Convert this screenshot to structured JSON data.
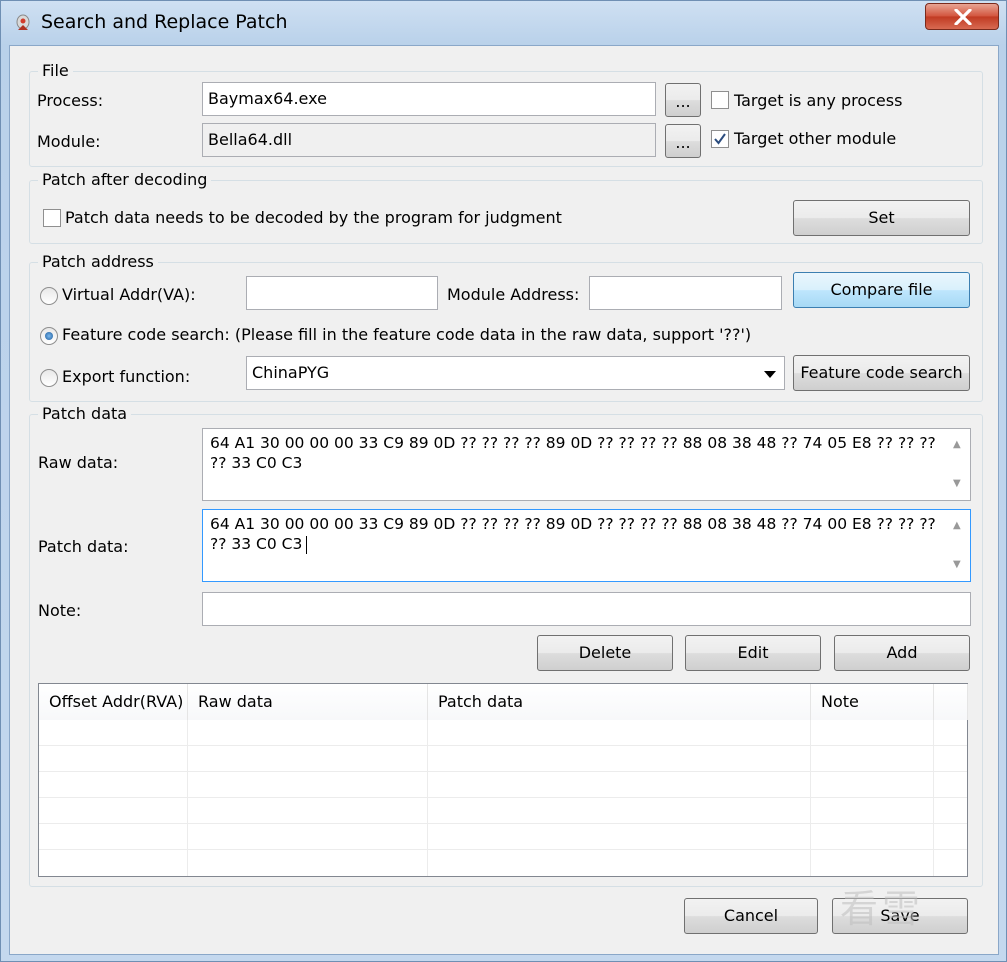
{
  "window": {
    "title": "Search and Replace Patch"
  },
  "file_group": {
    "label": "File",
    "process_label": "Process:",
    "process_value": "Baymax64.exe",
    "module_label": "Module:",
    "module_value": "Bella64.dll",
    "browse_label": "...",
    "target_any_process": {
      "label": "Target is any process",
      "checked": false
    },
    "target_other_module": {
      "label": "Target other module",
      "checked": true
    }
  },
  "decode_group": {
    "label": "Patch after decoding",
    "checkbox": {
      "label": "Patch data needs to be decoded by the program for judgment",
      "checked": false
    },
    "set_button": "Set"
  },
  "address_group": {
    "label": "Patch address",
    "va_radio": {
      "label": "Virtual Addr(VA):",
      "selected": false
    },
    "va_value": "",
    "module_address_label": "Module Address:",
    "module_address_value": "",
    "compare_button": "Compare file",
    "feature_radio": {
      "label": "Feature code search: (Please fill in the feature code data in the raw data, support '??')",
      "selected": true
    },
    "export_radio": {
      "label": "Export function:",
      "selected": false
    },
    "export_value": "ChinaPYG",
    "feature_search_button": "Feature code search"
  },
  "patch_group": {
    "label": "Patch data",
    "raw_label": "Raw data:",
    "raw_value": "64 A1 30 00 00 00 33 C9 89 0D ?? ?? ?? ?? 89 0D ?? ?? ?? ?? 88 08 38 48 ?? 74 05 E8 ?? ?? ?? ?? 33 C0 C3",
    "patch_label": "Patch data:",
    "patch_value": "64 A1 30 00 00 00 33 C9 89 0D ?? ?? ?? ?? 89 0D ?? ?? ?? ?? 88 08 38 48 ?? 74 00 E8 ?? ?? ?? ?? 33 C0 C3",
    "note_label": "Note:",
    "note_value": "",
    "delete_button": "Delete",
    "edit_button": "Edit",
    "add_button": "Add"
  },
  "table": {
    "columns": [
      "Offset Addr(RVA)",
      "Raw data",
      "Patch data",
      "Note"
    ],
    "rows": []
  },
  "footer": {
    "cancel_button": "Cancel",
    "save_button": "Save"
  },
  "colors": {
    "accent": "#3399ff",
    "close_button": "#c7412a",
    "titlebar": "#b9d1ea"
  },
  "watermark": "看雪"
}
